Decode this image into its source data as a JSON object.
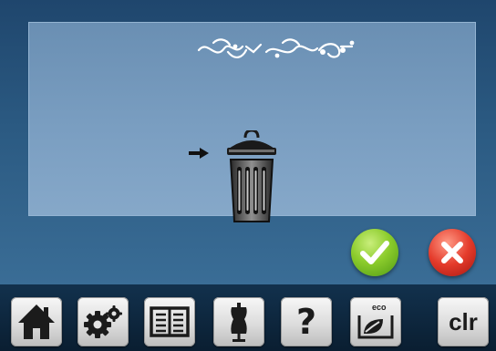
{
  "dialog": {
    "instruction_icon": "arrow-right-icon",
    "delete_icon": "trash-can-icon",
    "motif_icon": "embroidery-motif-icon"
  },
  "actions": {
    "confirm_icon": "checkmark-icon",
    "cancel_icon": "close-x-icon",
    "confirm_color": "#7cc42a",
    "cancel_color": "#d9302a"
  },
  "toolbar": {
    "buttons": [
      {
        "icon": "home-icon"
      },
      {
        "icon": "settings-gears-icon"
      },
      {
        "icon": "tutorial-book-icon"
      },
      {
        "icon": "dress-form-icon"
      },
      {
        "icon": "help-icon",
        "label": "?"
      },
      {
        "icon": "eco-mode-icon",
        "label": "eco"
      },
      {
        "icon": "clear-icon",
        "label": "clr"
      }
    ]
  }
}
